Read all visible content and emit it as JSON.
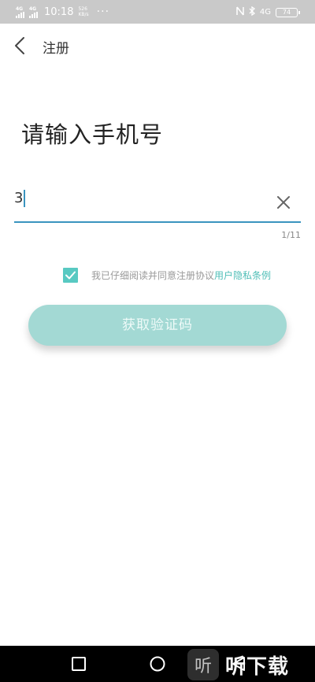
{
  "status_bar": {
    "network1": "4G",
    "network2": "4G",
    "time": "10:18",
    "speed_value": "526",
    "speed_unit": "KB/s",
    "more": "···",
    "network_right": "4G",
    "battery": "74"
  },
  "header": {
    "title": "注册",
    "back_icon": "chevron-left-icon"
  },
  "heading": "请输入手机号",
  "phone": {
    "value": "3",
    "counter": "1/11",
    "clear_icon": "close-icon"
  },
  "agreement": {
    "checked": true,
    "text": "我已仔细阅读并同意注册协议",
    "link": "用户隐私条例"
  },
  "button": {
    "label": "获取验证码"
  },
  "navbar": {
    "recent_icon": "square-icon",
    "home_icon": "circle-icon",
    "back_icon": "triangle-back-icon"
  },
  "watermark": {
    "logo": "听",
    "text": "听下载"
  },
  "colors": {
    "accent": "#3a94bf",
    "teal": "#58c9c2",
    "button": "#a3d9d4"
  }
}
